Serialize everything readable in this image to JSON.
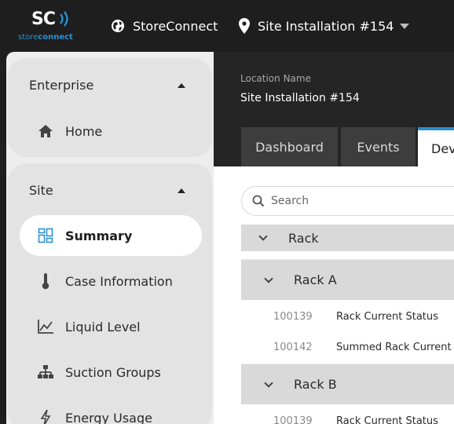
{
  "app": {
    "logo_mark": "SC",
    "logo_text_a": "store",
    "logo_text_b": "connect",
    "brand_color": "#2a8fd0"
  },
  "topbar": {
    "store_label": "StoreConnect",
    "store_icon": "globe-icon",
    "site_label": "Site Installation #154",
    "site_icon": "map-pin-icon"
  },
  "sidebar": {
    "groups": [
      {
        "title": "Enterprise",
        "items": [
          {
            "label": "Home",
            "icon": "home-icon"
          }
        ]
      },
      {
        "title": "Site",
        "items": [
          {
            "label": "Summary",
            "icon": "dashboard-grid-icon",
            "active": true
          },
          {
            "label": "Case Information",
            "icon": "thermometer-icon"
          },
          {
            "label": "Liquid Level",
            "icon": "line-chart-icon"
          },
          {
            "label": "Suction Groups",
            "icon": "hierarchy-icon"
          },
          {
            "label": "Energy Usage",
            "icon": "lightning-icon"
          }
        ]
      }
    ]
  },
  "header": {
    "location_label": "Location Name",
    "location_value": "Site Installation #154",
    "tabs": [
      {
        "label": "Dashboard"
      },
      {
        "label": "Events"
      },
      {
        "label": "Dev",
        "active": true
      }
    ]
  },
  "main": {
    "search": {
      "placeholder": "Search"
    },
    "rack_label": "Rack",
    "racks": [
      {
        "name": "Rack A",
        "points": [
          {
            "id": "100139",
            "name": "Rack Current Status"
          },
          {
            "id": "100142",
            "name": "Summed Rack Current"
          }
        ]
      },
      {
        "name": "Rack B",
        "points": [
          {
            "id": "100139",
            "name": "Rack Current Status"
          }
        ]
      }
    ]
  }
}
